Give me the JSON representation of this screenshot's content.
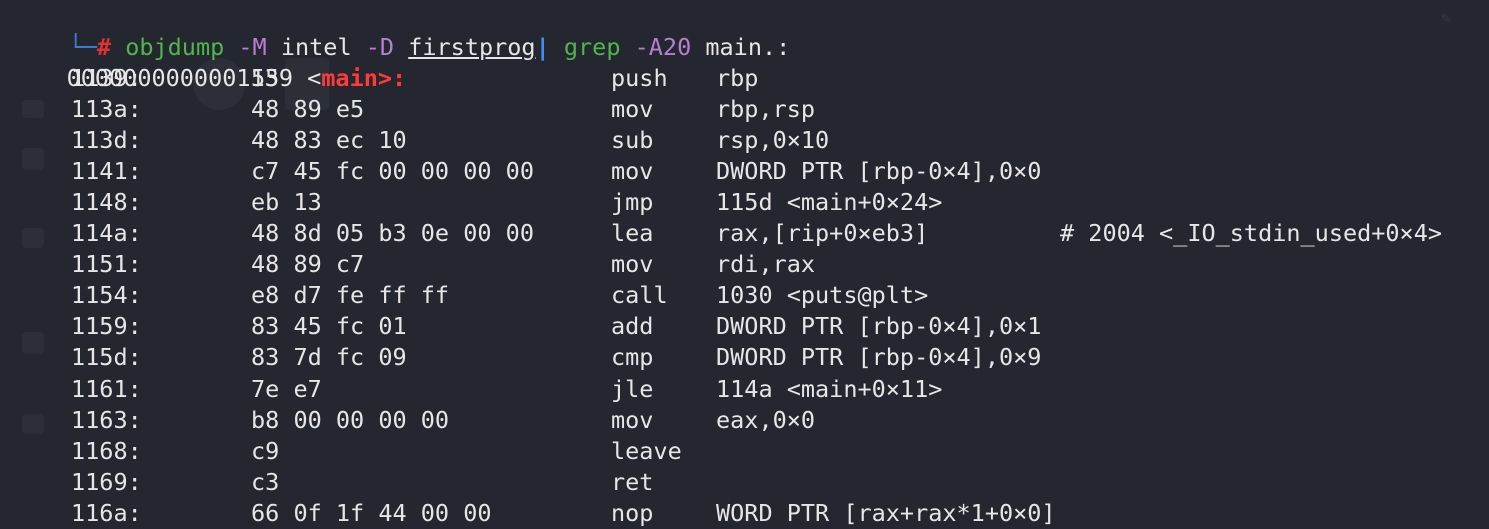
{
  "prompt": {
    "corner": "└─",
    "hash": "#",
    "command": "objdump",
    "opt_m": "-M",
    "intel": "intel",
    "opt_d": "-D",
    "file": "firstprog",
    "pipe": "|",
    "grep": "grep",
    "opt_a": "-A20",
    "pattern": "main.:"
  },
  "function_header": {
    "address": "0000000000001139",
    "open": "<",
    "name": "main>:"
  },
  "instructions": [
    {
      "addr": "1139:",
      "bytes": "55",
      "mnem": "push",
      "ops": "rbp",
      "comment": ""
    },
    {
      "addr": "113a:",
      "bytes": "48 89 e5",
      "mnem": "mov",
      "ops": "rbp,rsp",
      "comment": ""
    },
    {
      "addr": "113d:",
      "bytes": "48 83 ec 10",
      "mnem": "sub",
      "ops": "rsp,0×10",
      "comment": ""
    },
    {
      "addr": "1141:",
      "bytes": "c7 45 fc 00 00 00 00",
      "mnem": "mov",
      "ops": "DWORD PTR [rbp-0×4],0×0",
      "comment": ""
    },
    {
      "addr": "1148:",
      "bytes": "eb 13",
      "mnem": "jmp",
      "ops": "115d <main+0×24>",
      "comment": ""
    },
    {
      "addr": "114a:",
      "bytes": "48 8d 05 b3 0e 00 00",
      "mnem": "lea",
      "ops": "rax,[rip+0×eb3]",
      "comment": "# 2004 <_IO_stdin_used+0×4>"
    },
    {
      "addr": "1151:",
      "bytes": "48 89 c7",
      "mnem": "mov",
      "ops": "rdi,rax",
      "comment": ""
    },
    {
      "addr": "1154:",
      "bytes": "e8 d7 fe ff ff",
      "mnem": "call",
      "ops": "1030 <puts@plt>",
      "comment": ""
    },
    {
      "addr": "1159:",
      "bytes": "83 45 fc 01",
      "mnem": "add",
      "ops": "DWORD PTR [rbp-0×4],0×1",
      "comment": ""
    },
    {
      "addr": "115d:",
      "bytes": "83 7d fc 09",
      "mnem": "cmp",
      "ops": "DWORD PTR [rbp-0×4],0×9",
      "comment": ""
    },
    {
      "addr": "1161:",
      "bytes": "7e e7",
      "mnem": "jle",
      "ops": "114a <main+0×11>",
      "comment": ""
    },
    {
      "addr": "1163:",
      "bytes": "b8 00 00 00 00",
      "mnem": "mov",
      "ops": "eax,0×0",
      "comment": ""
    },
    {
      "addr": "1168:",
      "bytes": "c9",
      "mnem": "leave",
      "ops": "",
      "comment": ""
    },
    {
      "addr": "1169:",
      "bytes": "c3",
      "mnem": "ret",
      "ops": "",
      "comment": ""
    },
    {
      "addr": "116a:",
      "bytes": "66 0f 1f 44 00 00",
      "mnem": "nop",
      "ops": "WORD PTR [rax+rax*1+0×0]",
      "comment": ""
    }
  ],
  "colors": {
    "background": "#24272f",
    "prompt_hash": "#e0322f",
    "command": "#4fb64a",
    "option": "#b77fd0",
    "function_name": "#ff3a3a",
    "text": "#e6e6e6"
  },
  "icons": {
    "edit": "pencil-icon"
  }
}
